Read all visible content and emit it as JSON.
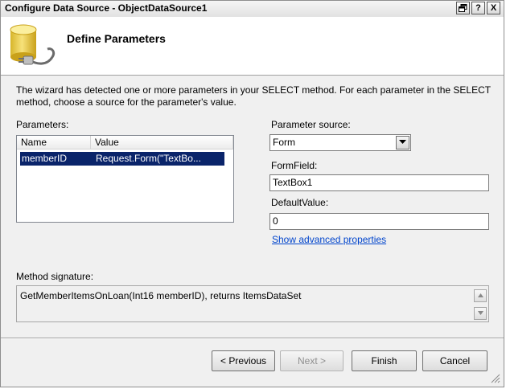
{
  "window": {
    "title": "Configure Data Source - ObjectDataSource1",
    "title_buttons": [
      "⧉",
      "?",
      "X"
    ]
  },
  "header": {
    "title": "Define Parameters",
    "icon": "database-plug-icon"
  },
  "description": "The wizard has detected one or more parameters in your SELECT method. For each parameter in the SELECT method, choose a source for the parameter's value.",
  "description_lines": [
    "The wizard has detected one or more parameters in your SELECT method. For each parameter in the SELECT",
    "method, choose a source for the parameter's value."
  ],
  "parameters": {
    "label": "Parameters:",
    "columns": [
      "Name",
      "Value"
    ],
    "rows": [
      {
        "name": "memberID",
        "value": "Request.Form(\"TextBo..."
      }
    ]
  },
  "parameter_source": {
    "label": "Parameter source:",
    "selected": "Form"
  },
  "form_field": {
    "label": "FormField:",
    "value": "TextBox1"
  },
  "default_value": {
    "label": "DefaultValue:",
    "value": "0"
  },
  "advanced_link": "Show advanced properties",
  "method_signature": {
    "label": "Method signature:",
    "value": "GetMemberItemsOnLoan(Int16 memberID), returns ItemsDataSet"
  },
  "buttons": {
    "previous": "< Previous",
    "next": "Next >",
    "finish": "Finish",
    "cancel": "Cancel"
  },
  "colors": {
    "selection": "#0a246a",
    "link": "#0044cc",
    "dialog_bg": "#f0f0f0"
  }
}
